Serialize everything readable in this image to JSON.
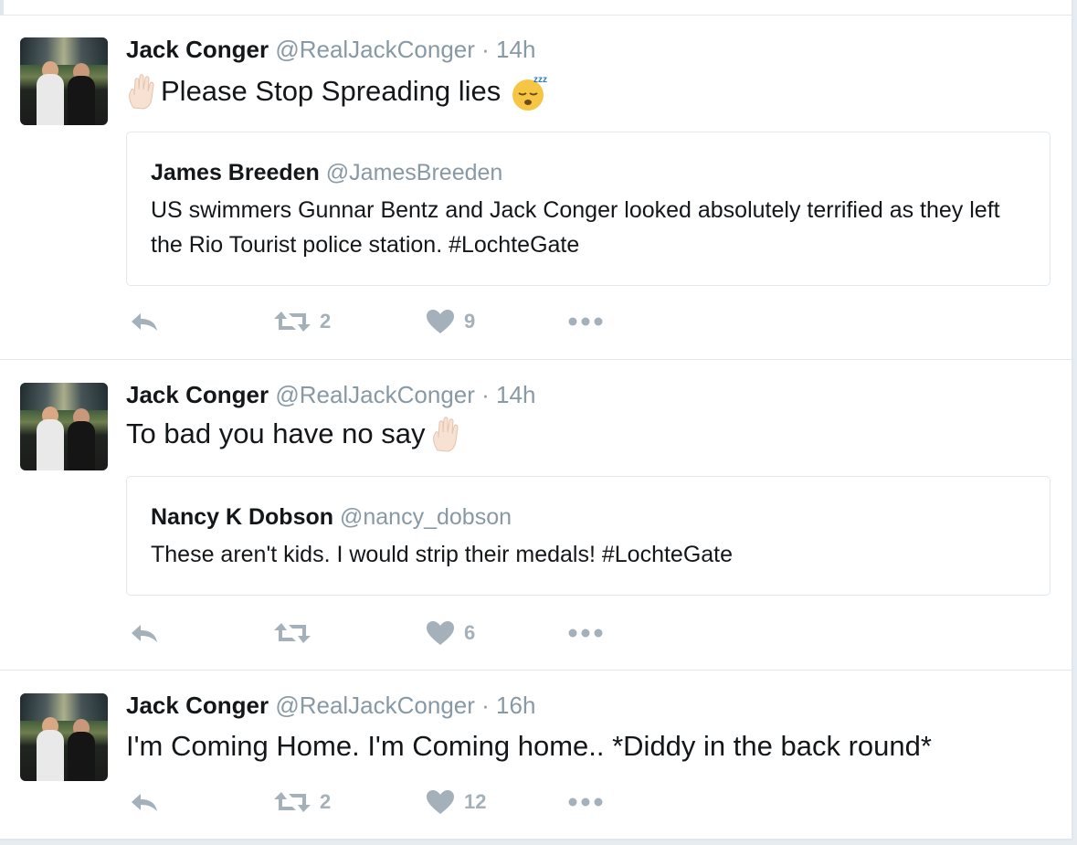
{
  "tweets": [
    {
      "name": "Jack Conger",
      "meta": "@RealJackConger · 14h",
      "text": "Please Stop Spreading lies",
      "quote": {
        "name": "James Breeden",
        "handle": "@JamesBreeden",
        "text": "US swimmers Gunnar Bentz and Jack Conger looked absolutely terrified as they left the Rio Tourist police station. #LochteGate"
      },
      "retweets": "2",
      "likes": "9"
    },
    {
      "name": "Jack Conger",
      "meta": "@RealJackConger · 14h",
      "text": "To bad you have no say",
      "quote": {
        "name": "Nancy K Dobson",
        "handle": "@nancy_dobson",
        "text": "These aren't kids. I would strip their medals! #LochteGate"
      },
      "retweets": "",
      "likes": "6"
    },
    {
      "name": "Jack Conger",
      "meta": "@RealJackConger · 16h",
      "text": "I'm Coming Home. I'm Coming home.. *Diddy in the back round*",
      "retweets": "2",
      "likes": "12"
    }
  ],
  "icons": {
    "reply": "reply-icon",
    "retweet": "retweet-icon",
    "like": "heart-icon",
    "more": "more-dots-icon",
    "raised_hand": "raised-hand-emoji",
    "sleeping": "sleeping-face-emoji"
  },
  "colors": {
    "action_gray": "#a4b0ba",
    "secondary_text": "#8899a6",
    "border": "#e1e8ed"
  }
}
